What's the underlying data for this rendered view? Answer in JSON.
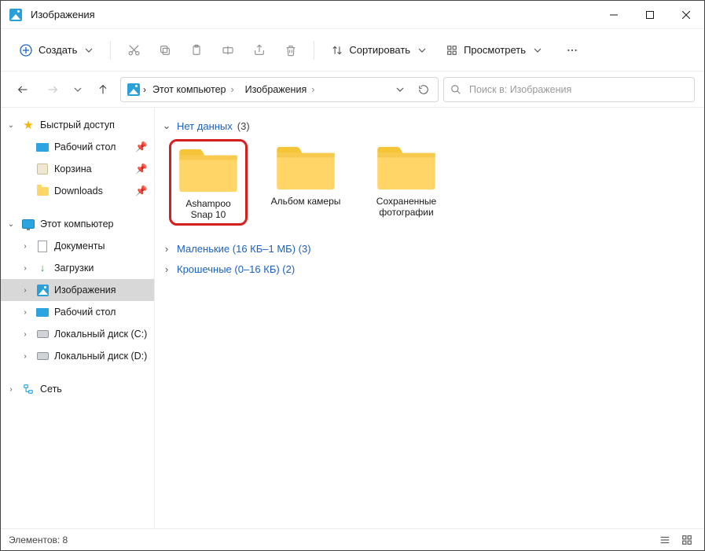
{
  "window": {
    "title": "Изображения"
  },
  "toolbar": {
    "create": "Создать",
    "sort": "Сортировать",
    "view": "Просмотреть"
  },
  "breadcrumbs": {
    "root": "Этот компьютер",
    "current": "Изображения"
  },
  "search": {
    "placeholder": "Поиск в: Изображения"
  },
  "sidebar": {
    "quick_access": "Быстрый доступ",
    "desktop": "Рабочий стол",
    "recycle": "Корзина",
    "downloads_qa": "Downloads",
    "this_pc": "Этот компьютер",
    "documents": "Документы",
    "downloads": "Загрузки",
    "pictures": "Изображения",
    "desktop2": "Рабочий стол",
    "disk_c": "Локальный диск (C:)",
    "disk_d": "Локальный диск (D:)",
    "network": "Сеть"
  },
  "groups": {
    "g0": {
      "label": "Нет данных",
      "count": "(3)"
    },
    "g1": {
      "full": "Маленькие (16 КБ–1 МБ) (3)"
    },
    "g2": {
      "full": "Крошечные (0–16 КБ) (2)"
    }
  },
  "folders": {
    "f0": "Ashampoo Snap 10",
    "f1": "Альбом камеры",
    "f2": "Сохраненные фотографии"
  },
  "status": {
    "items": "Элементов: 8"
  }
}
